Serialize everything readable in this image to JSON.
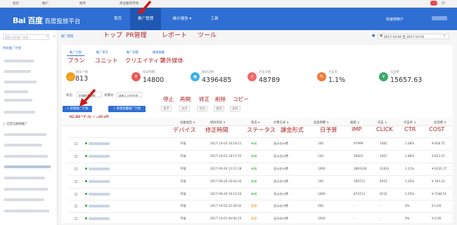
{
  "topbar": {
    "home": "首页",
    "account": "账户",
    "finance": "财务",
    "market": "商业服务市场"
  },
  "header": {
    "logo_main": "Bai 百度",
    "logo_sub": "百度投放平台",
    "nav": [
      {
        "label": "首页"
      },
      {
        "label": "推广管理"
      },
      {
        "label": "统计报告 ▾"
      },
      {
        "label": "工具"
      }
    ],
    "user_label": "快速搜索户"
  },
  "annotations": {
    "top": "トップ",
    "pr": "PR管理",
    "report": "レポート",
    "tool": "ツール",
    "plan": "プラン",
    "unit": "ユニット",
    "creative": "クリエイティブ",
    "exclude": "除外媒体",
    "new_plan": "新規プラン作成",
    "stop": "停止",
    "resume": "再開",
    "edit": "修正",
    "delete": "削除",
    "copy": "コピー",
    "device": "デバイス",
    "mod_time": "修正時間",
    "status": "ステータス",
    "billing": "課金形式",
    "budget": "日予算",
    "imp": "IMP",
    "click": "CLICK",
    "ctr": "CTR",
    "cost": "COST"
  },
  "sidebar": {
    "search_placeholder": "搜索计划/推广名称",
    "all_plans": "所有推广计划",
    "bottom_label": "已定向删除推广"
  },
  "breadcrumb": "推广管理",
  "date_range": "2017-10-04 至 2017-10-10",
  "tabs": [
    {
      "label": "推广计划"
    },
    {
      "label": "推广单元"
    },
    {
      "label": "推广创意"
    },
    {
      "label": "媒体屏蔽"
    }
  ],
  "stats": [
    {
      "label": "推荐个数",
      "value": "813",
      "color": "#f0a020",
      "icon": "ellipsis"
    },
    {
      "label": "每日预算",
      "value": "14800",
      "color": "#e85a5a",
      "icon": "yen"
    },
    {
      "label": "展现次数",
      "value": "4396485",
      "color": "#3bb2e8",
      "icon": "eye"
    },
    {
      "label": "点击次数",
      "value": "48789",
      "color": "#f06a6a",
      "icon": "pointer"
    },
    {
      "label": "点击率",
      "value": "1.1%",
      "color": "#f07a3a",
      "icon": "percent"
    },
    {
      "label": "总消费",
      "value": "15657.63",
      "color": "#3aaa6a",
      "icon": "yen"
    }
  ],
  "filters": {
    "status_label": "状态：",
    "status_value": "全部状态删除",
    "keyword_label": "关键词：",
    "keyword_value": "请输入计划名称"
  },
  "actions": {
    "new_plan": "+ 新建推广计划",
    "new_batch": "+ 新建批量推广计划",
    "pause": "暂停",
    "resume": "启用",
    "edit": "修改",
    "delete": "删除",
    "copy": "复制"
  },
  "table": {
    "headers": [
      "设备类型 ⇕",
      "修改时间 ⇕",
      "状态 ▾",
      "计费方式 ⇕",
      "投放预算 ⇕",
      "展现 ⇕",
      "点击 ⇕",
      "点击率 ⇕",
      "总消费 ⇕"
    ],
    "rows": [
      {
        "device": "不限",
        "time": "2017-10-03 16:18:11",
        "status": "有效",
        "billing": "显示总计费",
        "budget": "100",
        "imp": "97999",
        "click": "1081",
        "ctr": "1.08%",
        "cost": "¥ 828.75"
      },
      {
        "device": "不限",
        "time": "2017-10-03 18:17:55",
        "status": "有效",
        "billing": "显示总计费",
        "budget": "100",
        "imp": "56822",
        "click": "1067",
        "ctr": "1.88%",
        "cost": "¥ 823.51"
      },
      {
        "device": "不限",
        "time": "2017-09-29 12:21:18",
        "status": "有效",
        "billing": "显示总计费",
        "budget": "1000",
        "imp": "2863104",
        "click": "31824",
        "ctr": "1.11%",
        "cost": "¥ 6220.17"
      },
      {
        "device": "不限",
        "time": "2017-09-29 16:04:33",
        "status": "有效",
        "billing": "显示总计费",
        "budget": "100",
        "imp": "369713",
        "click": "4453",
        "ctr": "1.20%",
        "cost": "¥ 783.23"
      },
      {
        "device": "不限",
        "time": "2017-09-29 19:53:16",
        "status": "有效",
        "billing": "显示总计费",
        "budget": "1000",
        "imp": "874713",
        "click": "9232",
        "ctr": "1.05%",
        "cost": "¥ 7184.51"
      },
      {
        "device": "不限",
        "time": "2017-10-02 22:28:32",
        "status": "暂停",
        "billing": "显示总计费",
        "budget": "500",
        "imp": "-",
        "click": "-",
        "ctr": "0%",
        "cost": "¥ 0.00"
      },
      {
        "device": "不限",
        "time": "2017-10-01 00:06:15",
        "status": "暂停",
        "billing": "显示总计费",
        "budget": "5000",
        "imp": "-",
        "click": "-",
        "ctr": "0%",
        "cost": "¥ 0.00"
      }
    ]
  }
}
